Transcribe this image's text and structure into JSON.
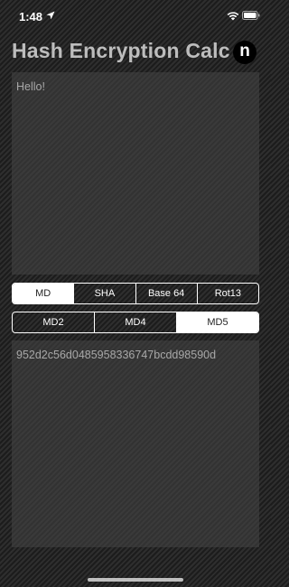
{
  "status_bar": {
    "time": "1:48",
    "icons": [
      "location-arrow-icon",
      "wifi-icon",
      "battery-icon"
    ]
  },
  "header": {
    "title": "Hash Encryption Calc",
    "logo_letter": "n"
  },
  "input": {
    "value": "Hello!"
  },
  "category_tabs": {
    "items": [
      {
        "label": "MD",
        "selected": true
      },
      {
        "label": "SHA",
        "selected": false
      },
      {
        "label": "Base 64",
        "selected": false
      },
      {
        "label": "Rot13",
        "selected": false
      }
    ]
  },
  "algorithm_tabs": {
    "items": [
      {
        "label": "MD2",
        "selected": false
      },
      {
        "label": "MD4",
        "selected": false
      },
      {
        "label": "MD5",
        "selected": true
      }
    ]
  },
  "output": {
    "value": "952d2c56d0485958336747bcdd98590d"
  },
  "colors": {
    "selected_segment_bg": "#ffffff",
    "segment_border": "#ffffff",
    "title_text": "#bdbdbd",
    "panel_text": "#a8a8a8"
  }
}
